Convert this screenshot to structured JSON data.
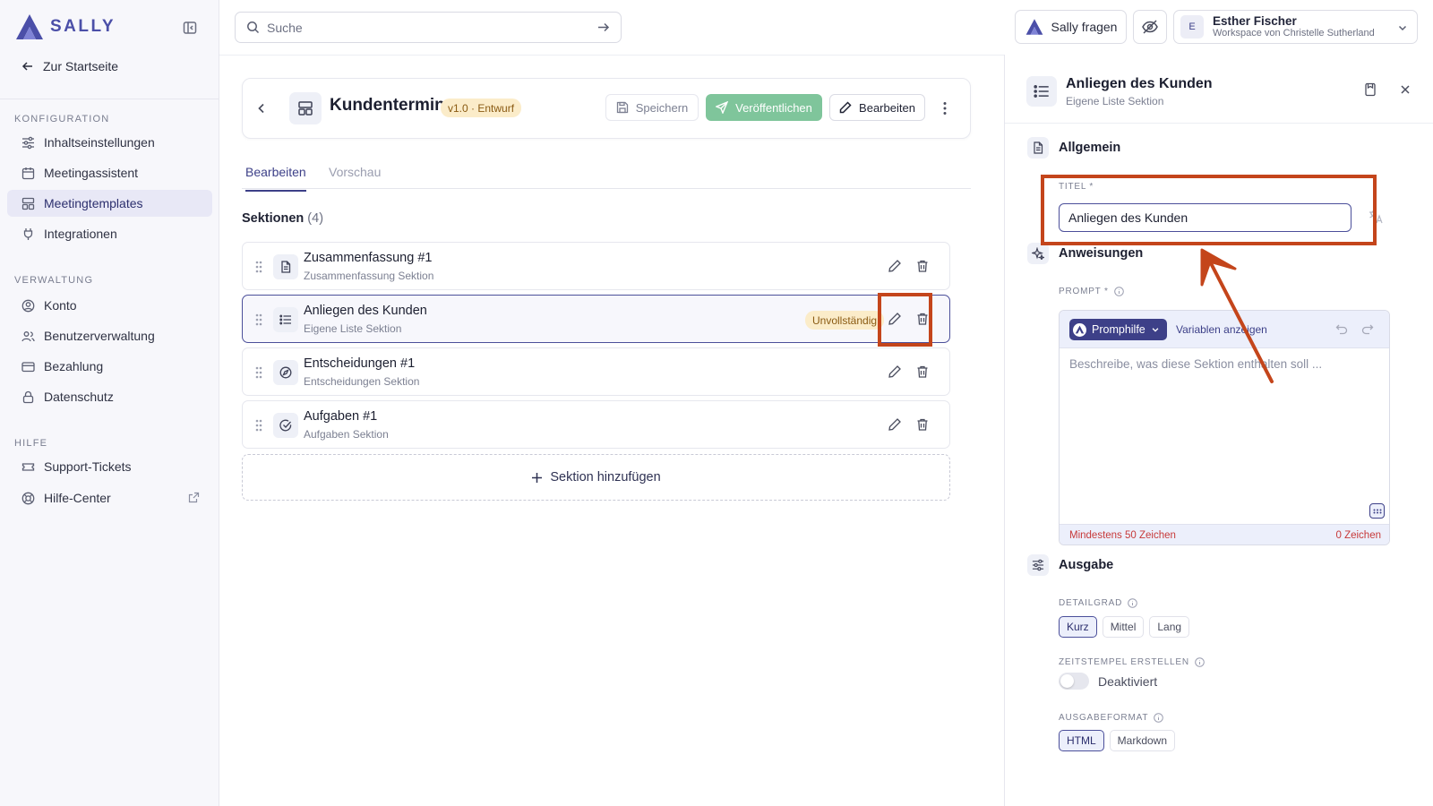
{
  "brand": {
    "name": "SALLY",
    "color": "#4b4fa8"
  },
  "sidebar": {
    "home_link": "Zur Startseite",
    "sections": [
      {
        "title": "KONFIGURATION",
        "items": [
          {
            "label": "Inhaltseinstellungen",
            "icon": "sliders-icon"
          },
          {
            "label": "Meetingassistent",
            "icon": "calendar-icon"
          },
          {
            "label": "Meetingtemplates",
            "icon": "template-icon",
            "active": true
          },
          {
            "label": "Integrationen",
            "icon": "plug-icon"
          }
        ]
      },
      {
        "title": "VERWALTUNG",
        "items": [
          {
            "label": "Konto",
            "icon": "user-circle-icon"
          },
          {
            "label": "Benutzerverwaltung",
            "icon": "users-icon"
          },
          {
            "label": "Bezahlung",
            "icon": "credit-card-icon"
          },
          {
            "label": "Datenschutz",
            "icon": "lock-icon"
          }
        ]
      },
      {
        "title": "HILFE",
        "items": [
          {
            "label": "Support-Tickets",
            "icon": "ticket-icon"
          },
          {
            "label": "Hilfe-Center",
            "icon": "lifebuoy-icon",
            "external": true
          }
        ]
      }
    ]
  },
  "topbar": {
    "search_placeholder": "Suche",
    "ask_sally": "Sally fragen",
    "user": {
      "initial": "E",
      "name": "Esther Fischer",
      "workspace": "Workspace von Christelle Sutherland"
    }
  },
  "editor": {
    "title": "Kundentermin",
    "version_badge": "v1.0 · Entwurf",
    "save_label": "Speichern",
    "publish_label": "Veröffentlichen",
    "edit_label": "Bearbeiten",
    "tabs": {
      "edit": "Bearbeiten",
      "preview": "Vorschau"
    },
    "sections_title": "Sektionen",
    "sections_count": "(4)",
    "sections": [
      {
        "name": "Zusammenfassung #1",
        "type": "Zusammenfassung Sektion",
        "icon": "document-icon"
      },
      {
        "name": "Anliegen des Kunden",
        "type": "Eigene Liste Sektion",
        "icon": "list-icon",
        "badge": "Unvollständig",
        "selected": true
      },
      {
        "name": "Entscheidungen #1",
        "type": "Entscheidungen Sektion",
        "icon": "compass-icon"
      },
      {
        "name": "Aufgaben #1",
        "type": "Aufgaben Sektion",
        "icon": "check-circle-icon"
      }
    ],
    "add_section": "Sektion hinzufügen"
  },
  "panel": {
    "title": "Anliegen des Kunden",
    "subtitle": "Eigene Liste Sektion",
    "general_title": "Allgemein",
    "title_label": "TITEL *",
    "title_value": "Anliegen des Kunden",
    "instructions_title": "Anweisungen",
    "prompt_label": "PROMPT *",
    "promphilfe": "Promphilfe",
    "show_variables": "Variablen anzeigen",
    "prompt_placeholder": "Beschreibe, was diese Sektion enthalten soll ...",
    "min_chars": "Mindestens 50 Zeichen",
    "char_count": "0 Zeichen",
    "output_title": "Ausgabe",
    "detail_label": "DETAILGRAD",
    "detail_options": [
      "Kurz",
      "Mittel",
      "Lang"
    ],
    "detail_selected": "Kurz",
    "timestamps_label": "ZEITSTEMPEL ERSTELLEN",
    "timestamps_value": "Deaktiviert",
    "format_label": "AUSGABEFORMAT",
    "format_options": [
      "HTML",
      "Markdown"
    ],
    "format_selected": "HTML"
  },
  "colors": {
    "accent": "#3d4088",
    "publish": "#7fc59b",
    "badge_bg": "#fbecc9",
    "error": "#c73a3a",
    "annotation": "#c4451b"
  }
}
